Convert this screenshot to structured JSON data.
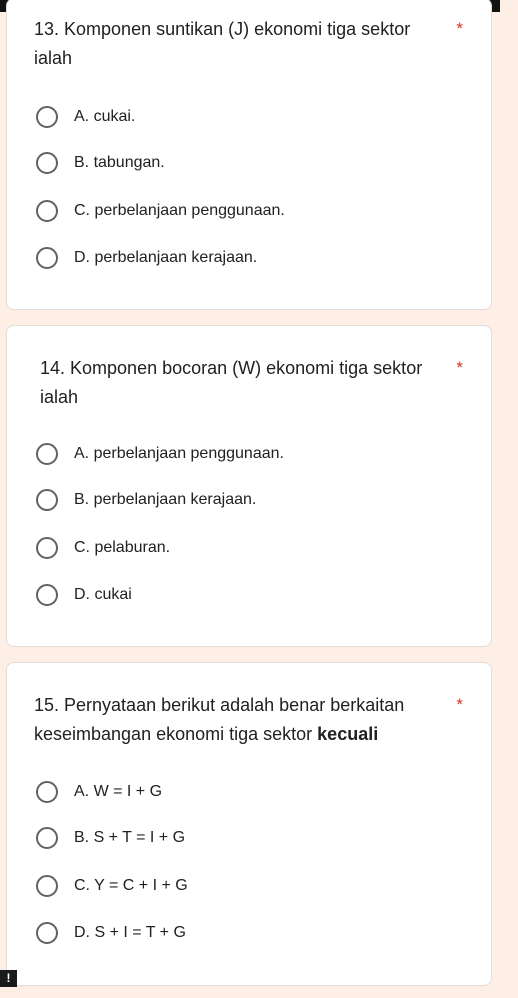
{
  "questions": [
    {
      "title": "13. Komponen suntikan (J) ekonomi tiga sektor ialah",
      "required_mark": "*",
      "options": [
        "A.  cukai.",
        "B.  tabungan.",
        "C.  perbelanjaan penggunaan.",
        "D.  perbelanjaan kerajaan."
      ]
    },
    {
      "title": "14. Komponen bocoran (W) ekonomi tiga sektor ialah",
      "required_mark": "*",
      "options": [
        "A.  perbelanjaan penggunaan.",
        "B.  perbelanjaan kerajaan.",
        "C.  pelaburan.",
        "D.  cukai"
      ]
    },
    {
      "title_prefix": "15. Pernyataan berikut adalah benar berkaitan keseimbangan ekonomi tiga sektor ",
      "title_bold": "kecuali",
      "required_mark": "*",
      "options": [
        "A.  W = I + G",
        "B.  S + T = I + G",
        "C.  Y = C + I + G",
        "D.  S + I = T + G"
      ]
    }
  ],
  "alert_badge": "!",
  "colors": {
    "background": "#fdeee6",
    "card": "#ffffff",
    "required": "#d93025",
    "radio_border": "#5f6368",
    "text": "#202124"
  }
}
